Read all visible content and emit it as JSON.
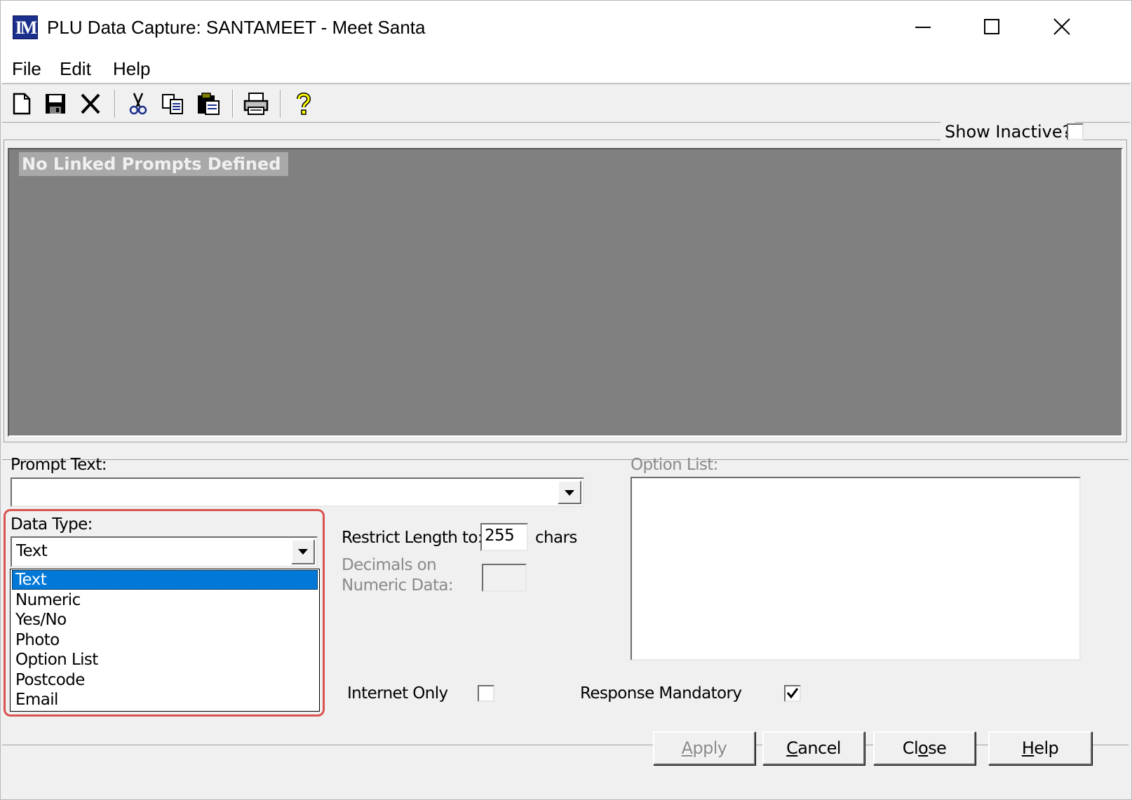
{
  "window": {
    "title": "PLU Data Capture: SANTAMEET - Meet Santa",
    "icon_label": "IM",
    "controls": [
      "minimize-icon",
      "maximize-icon",
      "close-icon"
    ]
  },
  "menu": {
    "file": "File",
    "edit": "Edit",
    "help": "Help"
  },
  "toolbar": {
    "icons": [
      "new-document-icon",
      "save-icon",
      "delete-icon",
      "cut-icon",
      "copy-icon",
      "paste-icon",
      "print-icon",
      "help-icon"
    ]
  },
  "linked_prompts": {
    "show_inactive_label": "Show Inactive?",
    "show_inactive_checked": false,
    "empty_message": "No Linked Prompts Defined"
  },
  "form": {
    "prompt_text_label": "Prompt Text:",
    "prompt_text_value": "",
    "option_list_label": "Option List:",
    "data_type_label": "Data Type:",
    "data_type_value": "Text",
    "data_type_options": [
      "Text",
      "Numeric",
      "Yes/No",
      "Photo",
      "Option List",
      "Postcode",
      "Email"
    ],
    "restrict_length_label": "Restrict Length to:",
    "restrict_length_value": "255",
    "chars_label": "chars",
    "decimals_label_line1": "Decimals on",
    "decimals_label_line2": "Numeric Data:",
    "decimals_value": "",
    "internet_only_label": "Internet Only",
    "internet_only_checked": false,
    "response_mandatory_label": "Response Mandatory",
    "response_mandatory_checked": true
  },
  "buttons": {
    "apply": {
      "prefix": "",
      "mnemonic": "A",
      "rest": "pply"
    },
    "cancel": {
      "prefix": "",
      "mnemonic": "C",
      "rest": "ancel"
    },
    "close": {
      "prefix": "Cl",
      "mnemonic": "o",
      "rest": "se"
    },
    "help": {
      "prefix": "",
      "mnemonic": "H",
      "rest": "elp"
    }
  },
  "colors": {
    "selection": "#0078d7",
    "highlight_border": "#d9534f",
    "panel_gray": "#808080"
  }
}
